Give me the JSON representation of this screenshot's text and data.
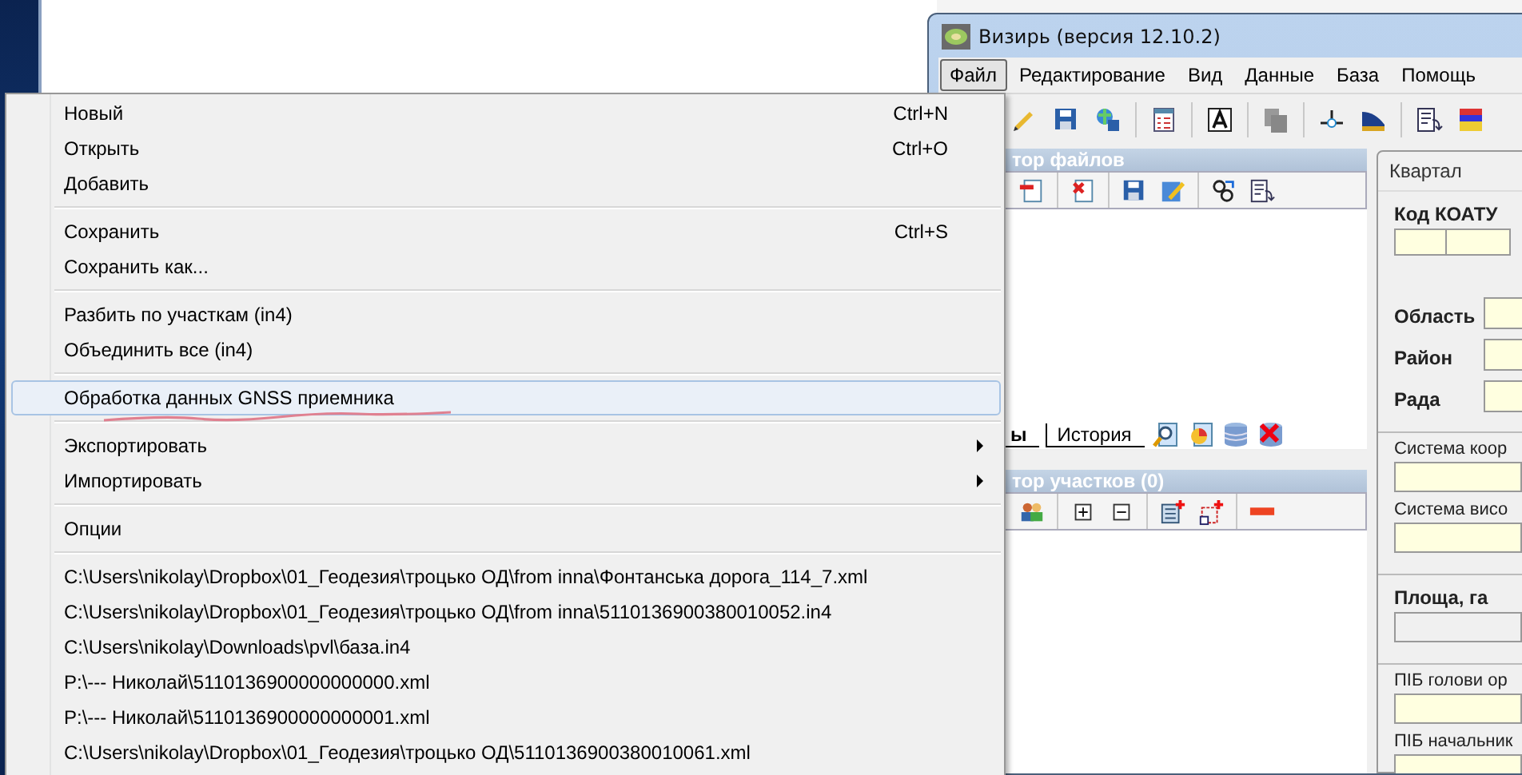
{
  "app_window": {
    "title": "Визирь (версия 12.10.2)",
    "menu_bar": [
      {
        "label": "Файл",
        "selected": true
      },
      {
        "label": "Редактирование",
        "selected": false
      },
      {
        "label": "Вид",
        "selected": false
      },
      {
        "label": "Данные",
        "selected": false
      },
      {
        "label": "База",
        "selected": false
      },
      {
        "label": "Помощь",
        "selected": false
      }
    ],
    "files_panel": {
      "header": "тор файлов",
      "tabs": [
        {
          "label": "ы",
          "selected": true
        },
        {
          "label": "История",
          "selected": false
        }
      ]
    },
    "plots_panel": {
      "header": "тор участков (0)"
    },
    "quarter_panel": {
      "title": "Квартал",
      "sections": [
        {
          "divided": false,
          "fields": [
            {
              "kind": "code",
              "label": "Код КОАТУ"
            }
          ]
        },
        {
          "divided": false,
          "fields": [
            {
              "kind": "inline",
              "label": "Область"
            },
            {
              "kind": "inline",
              "label": "Район"
            },
            {
              "kind": "inline",
              "label": "Рада"
            }
          ]
        },
        {
          "divided": true,
          "fields": [
            {
              "kind": "stacked",
              "label": "Система коор"
            },
            {
              "kind": "stacked",
              "label": "Система висо"
            }
          ]
        },
        {
          "divided": true,
          "fields": [
            {
              "kind": "area",
              "label": "Площа, га"
            }
          ]
        },
        {
          "divided": true,
          "fields": [
            {
              "kind": "stacked",
              "label": "ПІБ голови ор"
            },
            {
              "kind": "stacked",
              "label": "ПІБ начальник"
            }
          ]
        }
      ]
    }
  },
  "file_menu": {
    "groups": [
      [
        {
          "label": "Новый",
          "shortcut": "Ctrl+N",
          "selected": false
        },
        {
          "label": "Открыть",
          "shortcut": "Ctrl+O",
          "selected": false
        },
        {
          "label": "Добавить",
          "selected": false
        }
      ],
      [
        {
          "label": "Сохранить",
          "shortcut": "Ctrl+S",
          "selected": false
        },
        {
          "label": "Сохранить как...",
          "selected": false
        }
      ],
      [
        {
          "label": "Разбить по участкам (in4)",
          "selected": false
        },
        {
          "label": "Объединить все (in4)",
          "selected": false
        }
      ],
      [
        {
          "label": "Обработка данных GNSS приемника",
          "selected": true
        }
      ],
      [
        {
          "label": "Экспортировать",
          "submenu": true,
          "selected": false
        },
        {
          "label": "Импортировать",
          "submenu": true,
          "selected": false
        }
      ],
      [
        {
          "label": "Опции",
          "selected": false
        }
      ],
      [
        {
          "label": "C:\\Users\\nikolay\\Dropbox\\01_Геодезия\\троцько ОД\\from inna\\Фонтанська дорога_114_7.xml",
          "selected": false
        },
        {
          "label": "C:\\Users\\nikolay\\Dropbox\\01_Геодезия\\троцько ОД\\from inna\\5110136900380010052.in4",
          "selected": false
        },
        {
          "label": "C:\\Users\\nikolay\\Downloads\\pvl\\база.in4",
          "selected": false
        },
        {
          "label": "P:\\--- Николай\\5110136900000000000.xml",
          "selected": false
        },
        {
          "label": "P:\\--- Николай\\5110136900000000001.xml",
          "selected": false
        },
        {
          "label": "C:\\Users\\nikolay\\Dropbox\\01_Геодезия\\троцько ОД\\5110136900380010061.xml",
          "selected": false
        }
      ]
    ]
  }
}
